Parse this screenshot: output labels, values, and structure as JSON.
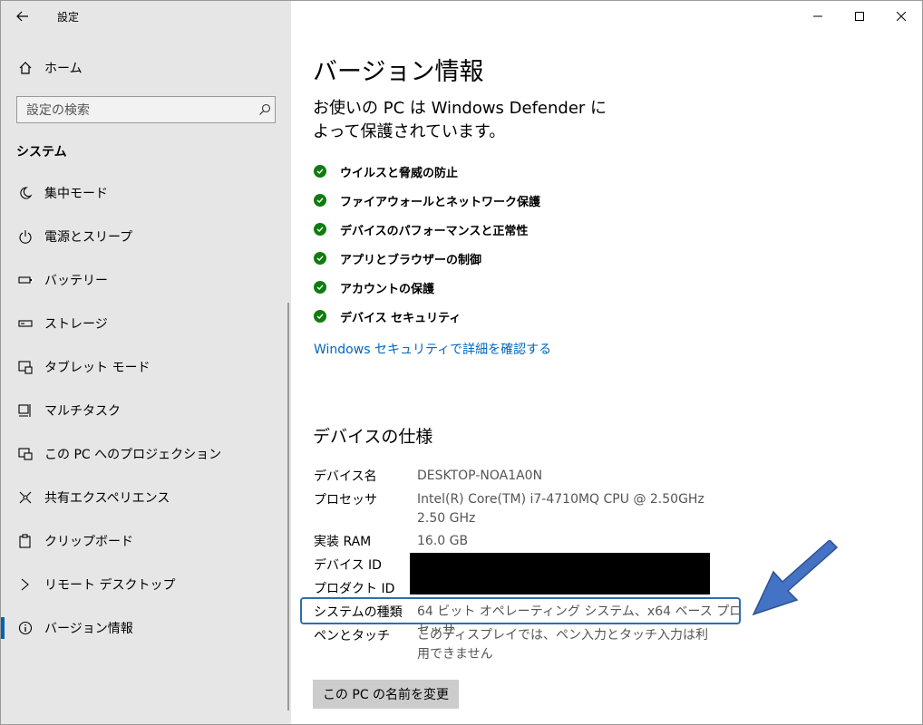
{
  "window": {
    "title": "設定"
  },
  "sidebar": {
    "home": "ホーム",
    "search": {
      "placeholder": "設定の検索"
    },
    "section": "システム",
    "items": [
      {
        "label": "集中モード",
        "icon": "moon-icon"
      },
      {
        "label": "電源とスリープ",
        "icon": "power-icon"
      },
      {
        "label": "バッテリー",
        "icon": "battery-icon"
      },
      {
        "label": "ストレージ",
        "icon": "storage-icon"
      },
      {
        "label": "タブレット モード",
        "icon": "tablet-icon"
      },
      {
        "label": "マルチタスク",
        "icon": "multitask-icon"
      },
      {
        "label": "この PC へのプロジェクション",
        "icon": "projection-icon"
      },
      {
        "label": "共有エクスペリエンス",
        "icon": "shared-icon"
      },
      {
        "label": "クリップボード",
        "icon": "clipboard-icon"
      },
      {
        "label": "リモート デスクトップ",
        "icon": "remote-icon"
      },
      {
        "label": "バージョン情報",
        "icon": "info-icon",
        "selected": true
      }
    ]
  },
  "main": {
    "title": "バージョン情報",
    "protection_text": "お使いの PC は Windows Defender によって保護されています。",
    "checks": [
      "ウイルスと脅威の防止",
      "ファイアウォールとネットワーク保護",
      "デバイスのパフォーマンスと正常性",
      "アプリとブラウザーの制御",
      "アカウントの保護",
      "デバイス セキュリティ"
    ],
    "security_link": "Windows セキュリティで詳細を確認する",
    "spec_title": "デバイスの仕様",
    "specs": [
      {
        "key": "デバイス名",
        "value": "DESKTOP-NOA1A0N"
      },
      {
        "key": "プロセッサ",
        "value": "Intel(R) Core(TM) i7-4710MQ CPU @ 2.50GHz 2.50 GHz"
      },
      {
        "key": "実装 RAM",
        "value": "16.0 GB"
      },
      {
        "key": "デバイス ID",
        "value": ""
      },
      {
        "key": "プロダクト ID",
        "value": ""
      },
      {
        "key": "システムの種類",
        "value": "64 ビット オペレーティング システム、x64 ベース プロセッサ"
      },
      {
        "key": "ペンとタッチ",
        "value": "このディスプレイでは、ペン入力とタッチ入力は利用できません"
      }
    ],
    "rename_button": "この PC の名前を変更"
  },
  "colors": {
    "accent": "#0063b1",
    "check": "#107c10",
    "link": "#0067c0",
    "highlight": "#2c6fad",
    "arrow": "#4472c4"
  }
}
